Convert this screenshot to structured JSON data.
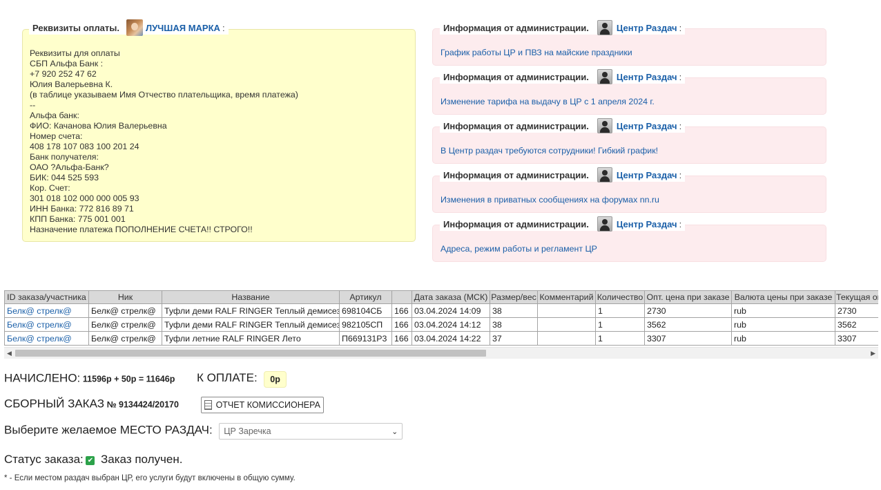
{
  "payment_panel": {
    "title": "Реквизиты оплаты.",
    "user": "ЛУЧШАЯ МАРКА",
    "colon": ":",
    "lines": [
      "Реквизиты для оплаты",
      "СБП Альфа Банк :",
      "+7 920 252 47 62",
      "Юлия Валерьевна К.",
      "(в таблице указываем Имя Отчество плательщика, время платежа)",
      "--",
      "Альфа банк:",
      "ФИО: Качанова Юлия Валерьевна",
      "Номер счета:",
      "408 178 107 083 100 201 24",
      "Банк получателя:",
      "ОАО ?Альфа-Банк?",
      "БИК: 044 525 593",
      "Кор. Счет:",
      "301 018 102 000 000 005 93",
      "ИНН Банка: 772 816 89 71",
      "КПП Банка: 775 001 001",
      "Назначение платежа ПОПОЛНЕНИЕ СЧЕТА!! СТРОГО!!"
    ]
  },
  "admin_notices": {
    "title": "Информация от администрации.",
    "user": "Центр Раздач",
    "colon": ":",
    "items": [
      {
        "link": "График работы ЦР и ПВЗ на майские праздники"
      },
      {
        "link": "Изменение тарифа на выдачу в ЦР с 1 апреля 2024 г."
      },
      {
        "link": "В Центр раздач требуются сотрудники! Гибкий график!"
      },
      {
        "link": "Изменения в приватных сообщениях на форумах nn.ru"
      },
      {
        "link": "Адреса, режим работы и регламент ЦР"
      }
    ]
  },
  "orders_table": {
    "headers": [
      "ID заказа/участника",
      "Ник",
      "Название",
      "Артикул",
      "",
      "Дата заказа (МСК)",
      "Размер/вес",
      "Комментарий",
      "Количество",
      "Опт. цена при заказе",
      "Валюта цены при заказе",
      "Текущая опт. цена"
    ],
    "rows": [
      [
        "Белк@ стрелк@",
        "Белк@ стрелк@",
        "Туфли деми RALF RINGER Теплый демисезон",
        "698104СБ",
        "166",
        "03.04.2024 14:09",
        "38",
        "",
        "1",
        "2730",
        "rub",
        "2730"
      ],
      [
        "Белк@ стрелк@",
        "Белк@ стрелк@",
        "Туфли деми RALF RINGER Теплый демисезон",
        "982105СП",
        "166",
        "03.04.2024 14:12",
        "38",
        "",
        "1",
        "3562",
        "rub",
        "3562"
      ],
      [
        "Белк@ стрелк@",
        "Белк@ стрелк@",
        "Туфли летние RALF RINGER Лето",
        "П669131Р3",
        "166",
        "03.04.2024 14:22",
        "37",
        "",
        "1",
        "3307",
        "rub",
        "3307"
      ]
    ]
  },
  "summary": {
    "accrued_label": "НАЧИСЛЕНО:",
    "accrued_value": "11596р + 50р = 11646р",
    "to_pay_label": "К ОПЛАТЕ:",
    "to_pay_value": "0р",
    "combined_order_label": "СБОРНЫЙ ЗАКАЗ",
    "combined_order_number": "№ 9134424/20170",
    "report_button": "ОТЧЕТ КОМИССИОНЕРА",
    "pickup_label": "Выберите желаемое МЕСТО РАЗДАЧ:",
    "pickup_selected": "ЦР Заречка",
    "status_label": "Статус заказа:",
    "status_value": "Заказ получен.",
    "footnote": "* - Если местом раздач выбран ЦР, его услуги будут включены в общую сумму."
  },
  "colors": {
    "link": "#1a5fa8",
    "payment_bg": "#ffffcc",
    "notice_bg": "#fdecee",
    "status_ok": "#2ca24a"
  }
}
